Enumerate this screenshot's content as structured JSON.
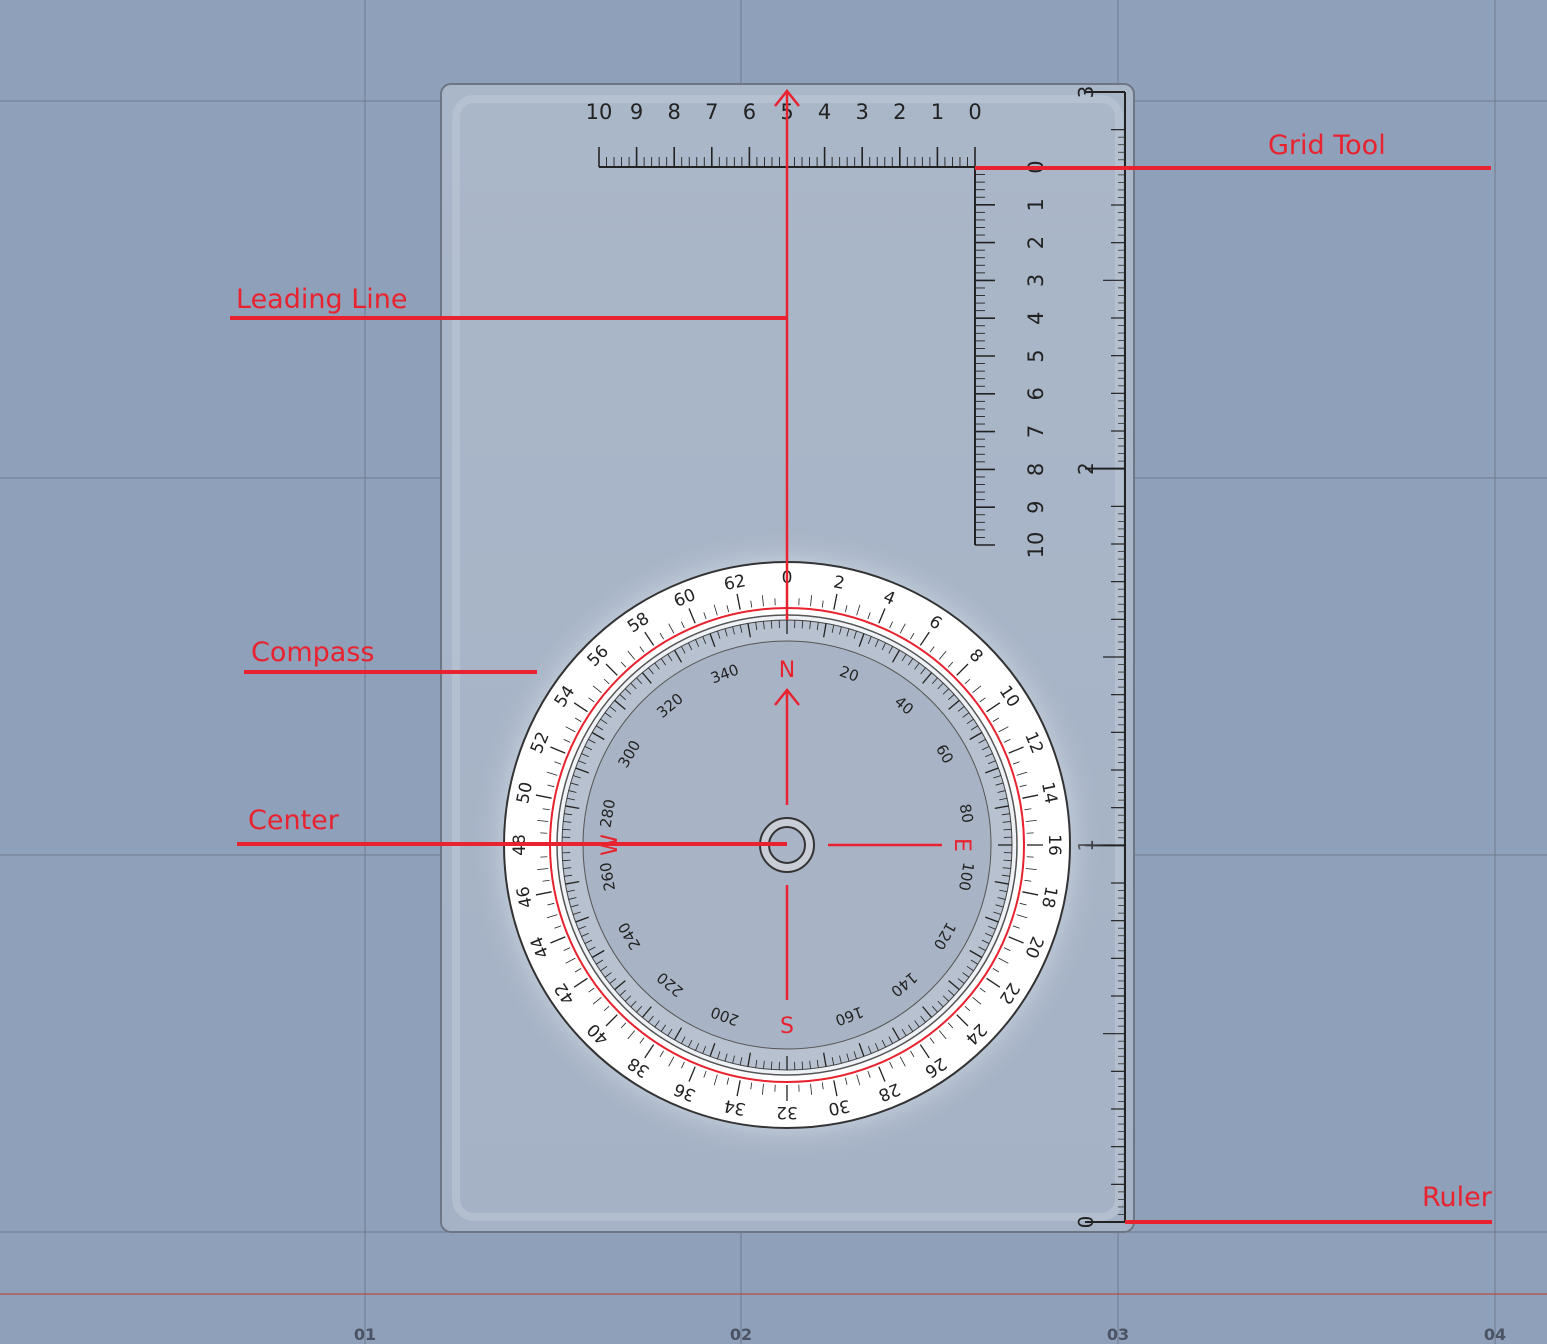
{
  "callouts": {
    "grid_tool": "Grid Tool",
    "leading_line": "Leading Line",
    "compass": "Compass",
    "center": "Center",
    "ruler": "Ruler"
  },
  "map_grid": {
    "bottom_labels": [
      "01",
      "02",
      "03",
      "04"
    ]
  },
  "grid_tool": {
    "horizontal_scale_labels": [
      "10",
      "9",
      "8",
      "7",
      "6",
      "5",
      "4",
      "3",
      "2",
      "1",
      "0"
    ],
    "vertical_scale_labels": [
      "0",
      "1",
      "2",
      "3",
      "4",
      "5",
      "6",
      "7",
      "8",
      "9",
      "10"
    ]
  },
  "ruler": {
    "labels": [
      "0",
      "1",
      "2",
      "3"
    ]
  },
  "compass": {
    "cardinals": {
      "north": "N",
      "east": "E",
      "south": "S",
      "west": "W"
    },
    "degree_labels": [
      "20",
      "40",
      "60",
      "80",
      "100",
      "120",
      "140",
      "160",
      "200",
      "220",
      "240",
      "260",
      "280",
      "300",
      "320",
      "340"
    ],
    "mils_labels": [
      "0",
      "2",
      "4",
      "6",
      "8",
      "10",
      "12",
      "14",
      "16",
      "18",
      "20",
      "22",
      "24",
      "26",
      "28",
      "30",
      "32",
      "34",
      "36",
      "38",
      "40",
      "42",
      "44",
      "46",
      "48",
      "50",
      "52",
      "54",
      "56",
      "58",
      "60",
      "62"
    ]
  },
  "colors": {
    "background": "#8fa1ba",
    "baseplate": "#a3b0c3",
    "accent_red": "#e8222e",
    "ink": "#222222"
  }
}
